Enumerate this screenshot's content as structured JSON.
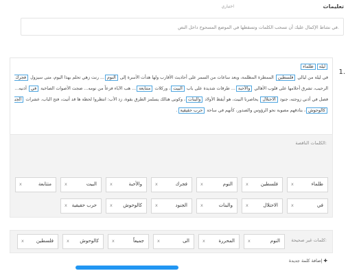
{
  "header": {
    "title": "تعليمات",
    "optional": "اختياري"
  },
  "instructions": "في نشاط الإكمال عليك أن تسحب الكلمات وتسقطها في الموضع المسحوح داخل النص.",
  "question": {
    "number": "1.",
    "lines": [
      [
        {
          "t": "ليلة",
          "b": true
        },
        {
          "t": "ظلماء",
          "b": true
        }
      ],
      [
        {
          "t": "في ليلة من ليالي "
        },
        {
          "t": "فلسطين",
          "b": true
        },
        {
          "t": " الممطرة المظلمة، وبعد ساعات من السمر على أحاديث الأقارب ولها هدأت الأسرة إلى "
        },
        {
          "t": "النوم",
          "b": true
        },
        {
          "t": "... رنت زهي تحلم بهذا اليوم، متى سيزول "
        },
        {
          "t": "فجرك",
          "b": true
        },
        {
          "t": "، وتسمع شمسه في الأفق"
        }
      ],
      [
        {
          "t": "الرحيب، تشرق أحلامها على قلوب الأهالي "
        },
        {
          "t": "والأحبة",
          "b": true
        },
        {
          "t": "... طرقات شديدة على باب "
        },
        {
          "t": "البيت",
          "b": true
        },
        {
          "t": "، وركلات "
        },
        {
          "t": "متتابعة",
          "b": true
        },
        {
          "t": "... هب الآباء فزعاً من نومه... ضجت الأصوات الصاخبة "
        },
        {
          "t": "في",
          "b": true
        },
        {
          "t": " أذنيه... فتح الباب...جيش...قتح"
        }
      ],
      [
        {
          "t": "فصل في أذني زوجته، جنود "
        },
        {
          "t": "الاحتلال",
          "b": true
        },
        {
          "t": " يحاصرنا البيت، هو أيقظ الأولاد "
        },
        {
          "t": "والبنات",
          "b": true
        },
        {
          "t": "، وكونى هنالك يسلمز الطرق بقوة، زد الأب: انتظروا لحظة ها قد أتيت، فتح الباب، عشرات "
        },
        {
          "t": "الجنود",
          "b": true
        },
        {
          "t": " اندفعوا إليه"
        }
      ],
      [
        {
          "t": "كالوحوش",
          "b": true
        },
        {
          "t": "، بنادقهم مصوبة نحو الرؤوس والصدور، كأنهم في ساحة "
        },
        {
          "t": "حرب حقيقية",
          "b": true
        },
        {
          "t": "."
        }
      ]
    ]
  },
  "missing_words": {
    "label": "الكلمات الناقصة:",
    "row1": [
      "ظلماء",
      "فلسطين",
      "النوم",
      "فجرك",
      "والأحبة",
      "البيت",
      "متتابعة"
    ],
    "row2": [
      "في",
      "الاحتلال",
      "والبنات",
      "الجنود",
      "كالوحوش",
      "حرب حقيقية"
    ]
  },
  "wrong_words": {
    "label": "كلمات غير صحيحة:",
    "items": [
      "النوم",
      "المحررة",
      "الى",
      "جميعاً",
      "كالوحوش",
      "فلسطين"
    ]
  },
  "add_link": "إضافة كلمة جديدة",
  "remove_glyph": "x"
}
